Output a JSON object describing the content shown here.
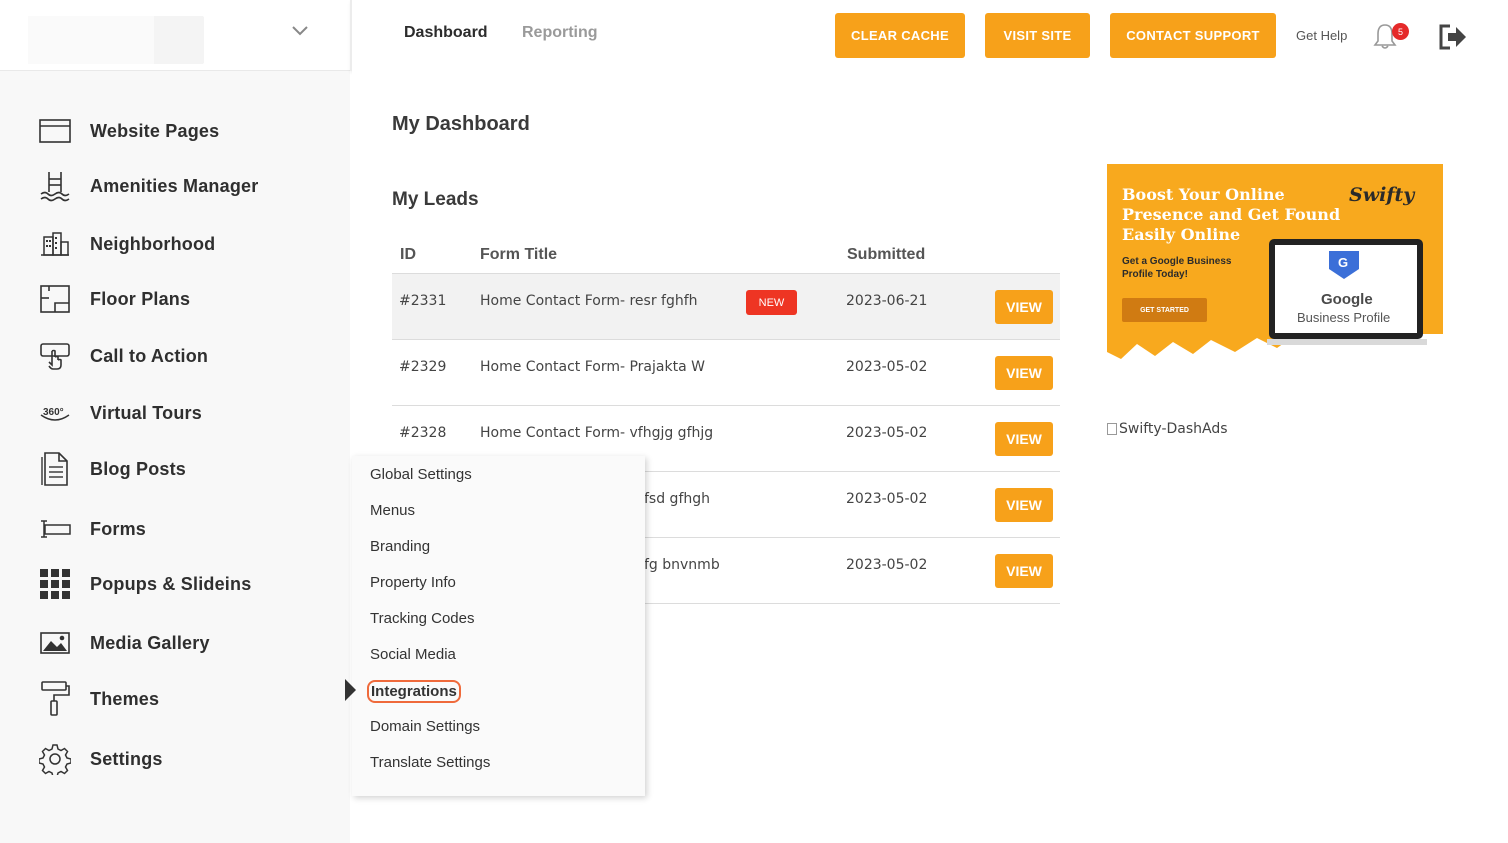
{
  "header": {
    "tabs": [
      {
        "label": "Dashboard",
        "active": true
      },
      {
        "label": "Reporting",
        "active": false
      }
    ],
    "buttons": {
      "clear_cache": "CLEAR CACHE",
      "visit_site": "VISIT SITE",
      "contact_support": "CONTACT SUPPORT"
    },
    "get_help": "Get Help",
    "notification_count": "5"
  },
  "sidebar": {
    "items": [
      {
        "label": "Website Pages",
        "icon": "browser-window-icon"
      },
      {
        "label": "Amenities Manager",
        "icon": "pool-ladder-icon"
      },
      {
        "label": "Neighborhood",
        "icon": "city-buildings-icon"
      },
      {
        "label": "Floor Plans",
        "icon": "floor-plan-icon"
      },
      {
        "label": "Call to Action",
        "icon": "pointer-click-icon"
      },
      {
        "label": "Virtual Tours",
        "icon": "360-view-icon"
      },
      {
        "label": "Blog Posts",
        "icon": "document-icon"
      },
      {
        "label": "Forms",
        "icon": "text-field-icon"
      },
      {
        "label": "Popups & Slideins",
        "icon": "grid-icon"
      },
      {
        "label": "Media Gallery",
        "icon": "image-icon"
      },
      {
        "label": "Themes",
        "icon": "paint-roller-icon"
      },
      {
        "label": "Settings",
        "icon": "gear-icon"
      }
    ]
  },
  "main": {
    "title": "My Dashboard",
    "leads": {
      "title": "My Leads",
      "columns": [
        "ID",
        "Form Title",
        "Submitted"
      ],
      "rows": [
        {
          "id": "#2331",
          "form": "Home Contact Form- resr fghfh",
          "date": "2023-06-21",
          "new": "NEW",
          "view": "VIEW"
        },
        {
          "id": "#2329",
          "form": "Home Contact Form- Prajakta W",
          "date": "2023-05-02",
          "view": "VIEW"
        },
        {
          "id": "#2328",
          "form": "Home Contact Form- vfhgjg gfhjg",
          "date": "2023-05-02",
          "view": "VIEW"
        },
        {
          "id": "",
          "form": "fsd gfhgh",
          "date": "2023-05-02",
          "view": "VIEW"
        },
        {
          "id": "",
          "form": "fg bnvnmb",
          "date": "2023-05-02",
          "view": "VIEW"
        }
      ]
    },
    "ad": {
      "heading": "Boost Your Online Presence and Get Found Easily Online",
      "subheading": "Get a Google Business Profile Today!",
      "cta": "GET STARTED",
      "brand": "Swifty",
      "google": "Google",
      "google_sub": "Business Profile"
    },
    "broken_image_alt": "Swifty-DashAds"
  },
  "settings_menu": {
    "items": [
      "Global Settings",
      "Menus",
      "Branding",
      "Property Info",
      "Tracking Codes",
      "Social Media",
      "Integrations",
      "Domain Settings",
      "Translate Settings"
    ],
    "highlighted": "Integrations"
  },
  "colors": {
    "accent": "#f7a11a",
    "badge_new": "#ee3523",
    "notification": "#e52a2a",
    "highlight_ring": "#ef6a3b"
  }
}
